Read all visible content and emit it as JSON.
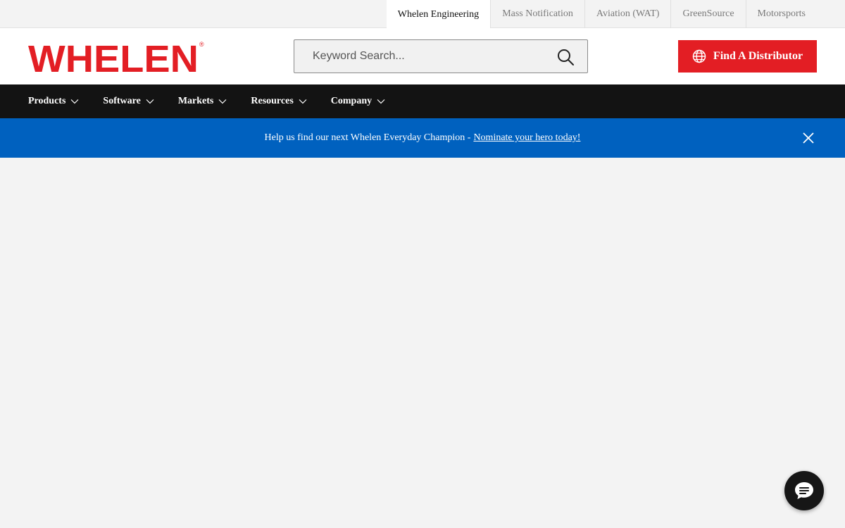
{
  "top_sites": {
    "tabs": [
      {
        "label": "Whelen Engineering",
        "active": true
      },
      {
        "label": "Mass Notification",
        "active": false
      },
      {
        "label": "Aviation (WAT)",
        "active": false
      },
      {
        "label": "GreenSource",
        "active": false
      },
      {
        "label": "Motorsports",
        "active": false
      }
    ]
  },
  "header": {
    "logo_text": "WHELEN",
    "logo_mark": "®",
    "search": {
      "placeholder": "Keyword Search...",
      "value": ""
    },
    "distributor_label": "Find A Distributor"
  },
  "nav": {
    "items": [
      {
        "label": "Products"
      },
      {
        "label": "Software"
      },
      {
        "label": "Markets"
      },
      {
        "label": "Resources"
      },
      {
        "label": "Company"
      }
    ]
  },
  "announcement": {
    "text": "Help us find our next Whelen Everyday Champion -",
    "link_text": "Nominate your hero today!"
  },
  "colors": {
    "brand_red": "#e31e24",
    "nav_bg": "#131313",
    "announce_bg": "#0061bf",
    "page_bg": "#f3f3f3"
  },
  "icons": {
    "search": "search-icon",
    "globe": "globe-icon",
    "chevron": "chevron-down-icon",
    "close": "close-icon",
    "chat": "chat-icon"
  }
}
